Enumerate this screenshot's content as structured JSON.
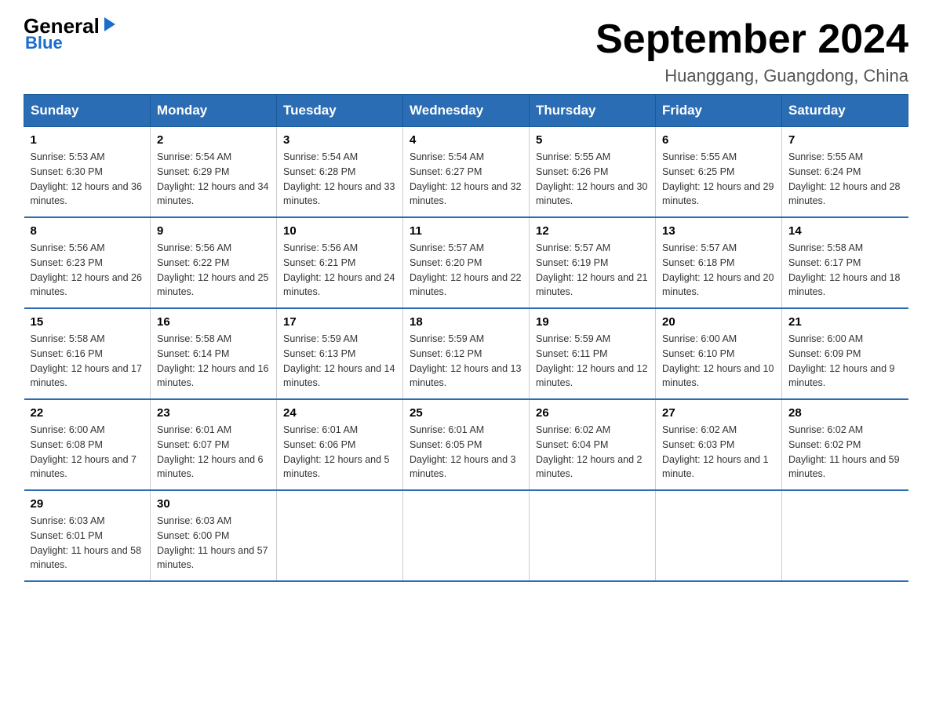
{
  "logo": {
    "general": "General",
    "arrow": "▶",
    "blue": "Blue"
  },
  "header": {
    "title": "September 2024",
    "subtitle": "Huanggang, Guangdong, China"
  },
  "weekdays": [
    "Sunday",
    "Monday",
    "Tuesday",
    "Wednesday",
    "Thursday",
    "Friday",
    "Saturday"
  ],
  "weeks": [
    [
      {
        "day": "1",
        "sunrise": "5:53 AM",
        "sunset": "6:30 PM",
        "daylight": "12 hours and 36 minutes."
      },
      {
        "day": "2",
        "sunrise": "5:54 AM",
        "sunset": "6:29 PM",
        "daylight": "12 hours and 34 minutes."
      },
      {
        "day": "3",
        "sunrise": "5:54 AM",
        "sunset": "6:28 PM",
        "daylight": "12 hours and 33 minutes."
      },
      {
        "day": "4",
        "sunrise": "5:54 AM",
        "sunset": "6:27 PM",
        "daylight": "12 hours and 32 minutes."
      },
      {
        "day": "5",
        "sunrise": "5:55 AM",
        "sunset": "6:26 PM",
        "daylight": "12 hours and 30 minutes."
      },
      {
        "day": "6",
        "sunrise": "5:55 AM",
        "sunset": "6:25 PM",
        "daylight": "12 hours and 29 minutes."
      },
      {
        "day": "7",
        "sunrise": "5:55 AM",
        "sunset": "6:24 PM",
        "daylight": "12 hours and 28 minutes."
      }
    ],
    [
      {
        "day": "8",
        "sunrise": "5:56 AM",
        "sunset": "6:23 PM",
        "daylight": "12 hours and 26 minutes."
      },
      {
        "day": "9",
        "sunrise": "5:56 AM",
        "sunset": "6:22 PM",
        "daylight": "12 hours and 25 minutes."
      },
      {
        "day": "10",
        "sunrise": "5:56 AM",
        "sunset": "6:21 PM",
        "daylight": "12 hours and 24 minutes."
      },
      {
        "day": "11",
        "sunrise": "5:57 AM",
        "sunset": "6:20 PM",
        "daylight": "12 hours and 22 minutes."
      },
      {
        "day": "12",
        "sunrise": "5:57 AM",
        "sunset": "6:19 PM",
        "daylight": "12 hours and 21 minutes."
      },
      {
        "day": "13",
        "sunrise": "5:57 AM",
        "sunset": "6:18 PM",
        "daylight": "12 hours and 20 minutes."
      },
      {
        "day": "14",
        "sunrise": "5:58 AM",
        "sunset": "6:17 PM",
        "daylight": "12 hours and 18 minutes."
      }
    ],
    [
      {
        "day": "15",
        "sunrise": "5:58 AM",
        "sunset": "6:16 PM",
        "daylight": "12 hours and 17 minutes."
      },
      {
        "day": "16",
        "sunrise": "5:58 AM",
        "sunset": "6:14 PM",
        "daylight": "12 hours and 16 minutes."
      },
      {
        "day": "17",
        "sunrise": "5:59 AM",
        "sunset": "6:13 PM",
        "daylight": "12 hours and 14 minutes."
      },
      {
        "day": "18",
        "sunrise": "5:59 AM",
        "sunset": "6:12 PM",
        "daylight": "12 hours and 13 minutes."
      },
      {
        "day": "19",
        "sunrise": "5:59 AM",
        "sunset": "6:11 PM",
        "daylight": "12 hours and 12 minutes."
      },
      {
        "day": "20",
        "sunrise": "6:00 AM",
        "sunset": "6:10 PM",
        "daylight": "12 hours and 10 minutes."
      },
      {
        "day": "21",
        "sunrise": "6:00 AM",
        "sunset": "6:09 PM",
        "daylight": "12 hours and 9 minutes."
      }
    ],
    [
      {
        "day": "22",
        "sunrise": "6:00 AM",
        "sunset": "6:08 PM",
        "daylight": "12 hours and 7 minutes."
      },
      {
        "day": "23",
        "sunrise": "6:01 AM",
        "sunset": "6:07 PM",
        "daylight": "12 hours and 6 minutes."
      },
      {
        "day": "24",
        "sunrise": "6:01 AM",
        "sunset": "6:06 PM",
        "daylight": "12 hours and 5 minutes."
      },
      {
        "day": "25",
        "sunrise": "6:01 AM",
        "sunset": "6:05 PM",
        "daylight": "12 hours and 3 minutes."
      },
      {
        "day": "26",
        "sunrise": "6:02 AM",
        "sunset": "6:04 PM",
        "daylight": "12 hours and 2 minutes."
      },
      {
        "day": "27",
        "sunrise": "6:02 AM",
        "sunset": "6:03 PM",
        "daylight": "12 hours and 1 minute."
      },
      {
        "day": "28",
        "sunrise": "6:02 AM",
        "sunset": "6:02 PM",
        "daylight": "11 hours and 59 minutes."
      }
    ],
    [
      {
        "day": "29",
        "sunrise": "6:03 AM",
        "sunset": "6:01 PM",
        "daylight": "11 hours and 58 minutes."
      },
      {
        "day": "30",
        "sunrise": "6:03 AM",
        "sunset": "6:00 PM",
        "daylight": "11 hours and 57 minutes."
      },
      null,
      null,
      null,
      null,
      null
    ]
  ],
  "labels": {
    "sunrise": "Sunrise:",
    "sunset": "Sunset:",
    "daylight": "Daylight:"
  }
}
